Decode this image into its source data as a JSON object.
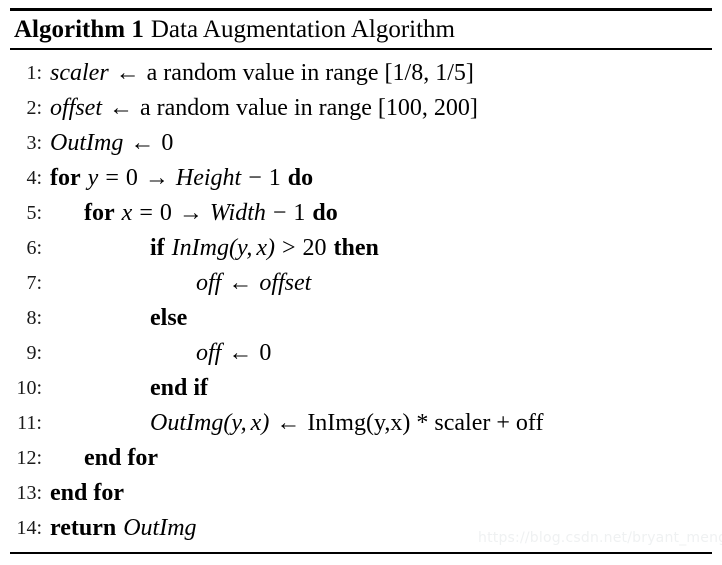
{
  "title": {
    "label": "Algorithm 1",
    "name": "Data Augmentation Algorithm"
  },
  "watermark": "https://blog.csdn.net/bryant_meng",
  "symbols": {
    "assign": "←",
    "to": "→",
    "minus": "−",
    "gt": ">",
    "eq": "=",
    "comma": ",",
    "lparen": "(",
    "rparen": ")",
    "star": "*",
    "plus": "+"
  },
  "lines": [
    {
      "no": "1:",
      "indent": 0,
      "text": "scaler ← a random value in range [1/8, 1/5]",
      "parts": {
        "var": "scaler",
        "arrow": "←",
        "prose": "a random value in range [1/8, 1/5]"
      }
    },
    {
      "no": "2:",
      "indent": 0,
      "text": "offset ← a random value in range [100, 200]",
      "parts": {
        "var": "offset",
        "arrow": "←",
        "prose": "a random value in range [100, 200]"
      }
    },
    {
      "no": "3:",
      "indent": 0,
      "text": "OutImg ← 0",
      "parts": {
        "var": "OutImg",
        "arrow": "←",
        "value": "0"
      }
    },
    {
      "no": "4:",
      "indent": 0,
      "text": "for y = 0 → Height − 1 do",
      "parts": {
        "kw1": "for",
        "v": "y",
        "eq": "=",
        "from": "0",
        "to": "→",
        "bound": "Height",
        "minus": "−",
        "one": "1",
        "kw2": "do"
      }
    },
    {
      "no": "5:",
      "indent": 1,
      "text": "for x = 0 → Width − 1 do",
      "parts": {
        "kw1": "for",
        "v": "x",
        "eq": "=",
        "from": "0",
        "to": "→",
        "bound": "Width",
        "minus": "−",
        "one": "1",
        "kw2": "do"
      }
    },
    {
      "no": "6:",
      "indent": 2,
      "text": "if InImg(y, x) > 20 then",
      "parts": {
        "kw1": "if",
        "fn": "InImg",
        "a1": "y",
        "a2": "x",
        "gt": ">",
        "num": "20",
        "kw2": "then"
      }
    },
    {
      "no": "7:",
      "indent": 3,
      "text": "off ← offset",
      "parts": {
        "lhs": "off",
        "arrow": "←",
        "rhs": "offset"
      }
    },
    {
      "no": "8:",
      "indent": 2,
      "text": "else",
      "parts": {
        "kw1": "else"
      }
    },
    {
      "no": "9:",
      "indent": 3,
      "text": "off ← 0",
      "parts": {
        "lhs": "off",
        "arrow": "←",
        "rhs": "0"
      }
    },
    {
      "no": "10:",
      "indent": 2,
      "text": "end if",
      "parts": {
        "kw1": "end if"
      }
    },
    {
      "no": "11:",
      "indent": 2,
      "text": "OutImg(y, x) ← InImg(y,x) * scaler + off",
      "parts": {
        "fn": "OutImg",
        "a1": "y",
        "a2": "x",
        "arrow": "←",
        "rhs": "InImg(y,x) * scaler + off"
      }
    },
    {
      "no": "12:",
      "indent": 1,
      "text": "end for",
      "parts": {
        "kw1": "end for"
      }
    },
    {
      "no": "13:",
      "indent": 0,
      "text": "end for",
      "parts": {
        "kw1": "end for"
      }
    },
    {
      "no": "14:",
      "indent": 0,
      "text": "return OutImg",
      "parts": {
        "kw1": "return",
        "var": "OutImg"
      }
    }
  ]
}
